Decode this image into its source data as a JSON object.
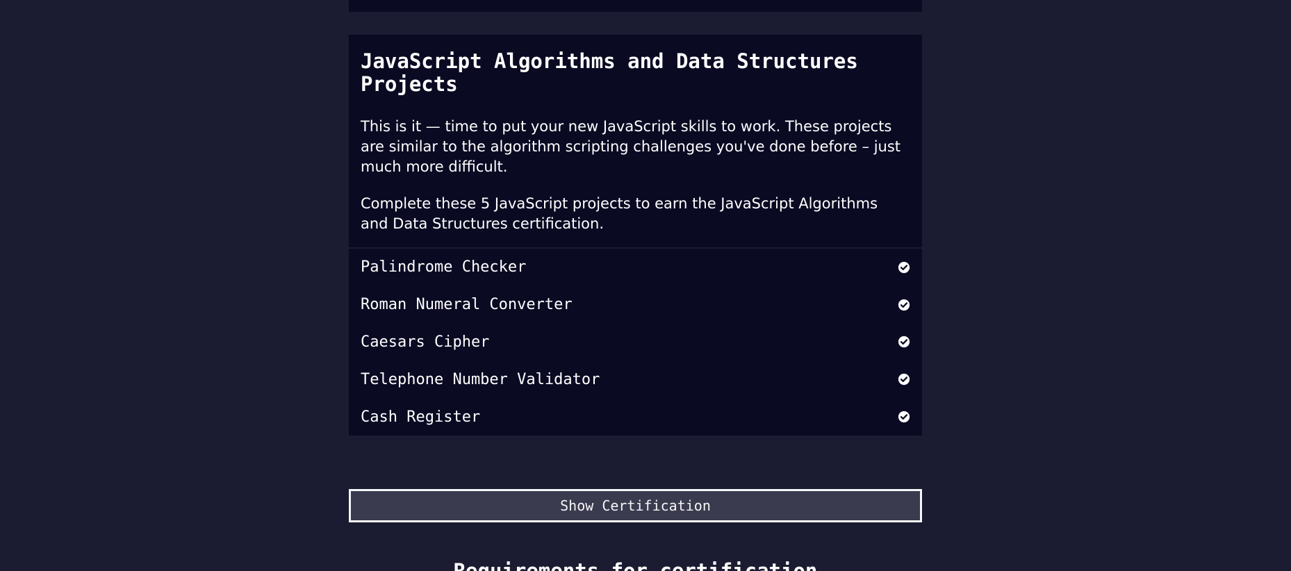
{
  "section": {
    "title": "JavaScript Algorithms and Data Structures Projects",
    "description_1": "This is it — time to put your new JavaScript skills to work. These projects are similar to the algorithm scripting challenges you've done before – just much more difficult.",
    "description_2": "Complete these 5 JavaScript projects to earn the JavaScript Algorithms and Data Structures certification.",
    "projects": [
      {
        "label": "Palindrome Checker",
        "icon": "check-circle-icon",
        "completed": true
      },
      {
        "label": "Roman Numeral Converter",
        "icon": "check-circle-icon",
        "completed": true
      },
      {
        "label": "Caesars Cipher",
        "icon": "check-circle-icon",
        "completed": true
      },
      {
        "label": "Telephone Number Validator",
        "icon": "check-circle-icon",
        "completed": true
      },
      {
        "label": "Cash Register",
        "icon": "check-circle-icon",
        "completed": true
      }
    ]
  },
  "certification_button": {
    "label": "Show Certification"
  },
  "next_section": {
    "title": "Requirements for certification"
  },
  "colors": {
    "page_background": "#1b1b32",
    "panel_background": "#0a0a23",
    "button_background": "#3b3b4f",
    "text": "#ffffff",
    "check_icon": "#ffffff"
  }
}
